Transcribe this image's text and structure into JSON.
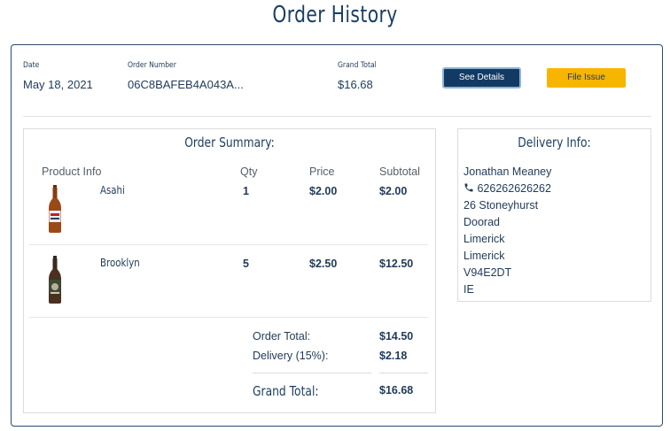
{
  "page": {
    "title": "Order History"
  },
  "order": {
    "date_label": "Date",
    "date_value": "May 18, 2021",
    "number_label": "Order Number",
    "number_value": "06C8BAFEB4A043A...",
    "total_label": "Grand Total",
    "total_value": "$16.68",
    "see_details_label": "See Details",
    "file_issue_label": "File Issue"
  },
  "summary": {
    "heading": "Order Summary:",
    "columns": [
      "Product Info",
      "Qty",
      "Price",
      "Subtotal"
    ],
    "items": [
      {
        "name": "Asahi",
        "qty": "1",
        "price": "$2.00",
        "subtotal": "$2.00"
      },
      {
        "name": "Brooklyn",
        "qty": "5",
        "price": "$2.50",
        "subtotal": "$12.50"
      }
    ],
    "order_total_label": "Order Total:",
    "order_total_value": "$14.50",
    "delivery_label": "Delivery (15%):",
    "delivery_value": "$2.18",
    "grand_total_label": "Grand Total:",
    "grand_total_value": "$16.68"
  },
  "delivery": {
    "heading": "Delivery Info:",
    "name": "Jonathan Meaney",
    "phone": "626262626262",
    "phone_icon": "phone-icon",
    "address": [
      "26 Stoneyhurst",
      "Doorad",
      "Limerick",
      "Limerick",
      "V94E2DT",
      "IE"
    ]
  },
  "colors": {
    "navy": "#123a63",
    "yellow": "#f7b500",
    "text": "#1f3a5a"
  }
}
